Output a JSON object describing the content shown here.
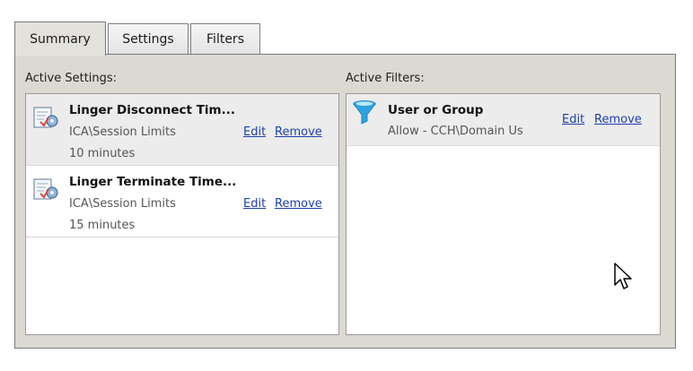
{
  "tabs": {
    "summary": "Summary",
    "settings": "Settings",
    "filters": "Filters"
  },
  "active_tab": "Summary",
  "active_settings": {
    "title": "Active Settings:",
    "items": [
      {
        "name": "Linger Disconnect Tim...",
        "path": "ICA\\Session Limits",
        "value": "10 minutes",
        "edit_label": "Edit",
        "remove_label": "Remove",
        "icon": "policy-setting-icon"
      },
      {
        "name": "Linger Terminate Time...",
        "path": "ICA\\Session Limits",
        "value": "15 minutes",
        "edit_label": "Edit",
        "remove_label": "Remove",
        "icon": "policy-setting-icon"
      }
    ]
  },
  "active_filters": {
    "title": "Active Filters:",
    "items": [
      {
        "name": "User or Group",
        "detail": "Allow - CCH\\Domain Us",
        "edit_label": "Edit",
        "remove_label": "Remove",
        "icon": "funnel-filter-icon"
      }
    ]
  },
  "colors": {
    "link": "#1f3fa8",
    "panel_background": "#dcd9d2",
    "selected_row": "#ececec",
    "filter_icon": "#2fa3dd"
  }
}
